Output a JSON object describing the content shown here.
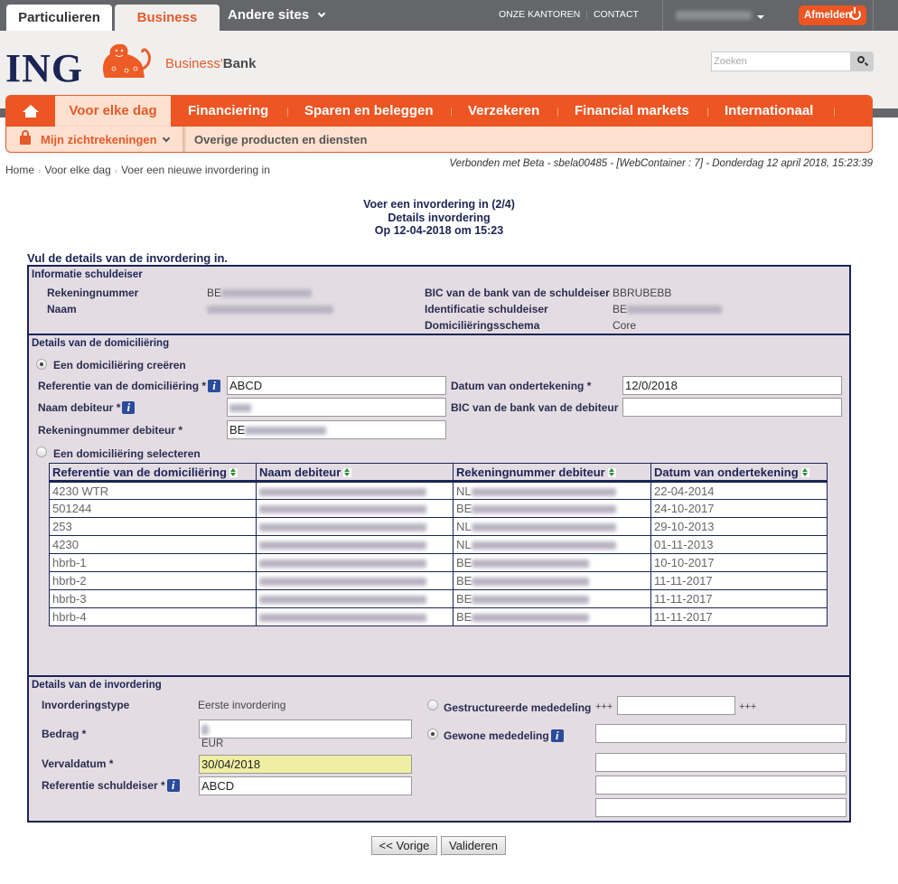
{
  "topbar": {
    "tabs": [
      "Particulieren",
      "Business"
    ],
    "other_sites": "Andere sites",
    "links": [
      "ONZE KANTOREN",
      "CONTACT"
    ],
    "logout": "Afmelden"
  },
  "header": {
    "logo": "ING",
    "brand_prefix": "Business'",
    "brand_suffix": "Bank",
    "search_placeholder": "Zoeken"
  },
  "nav": {
    "items": [
      "Voor elke dag",
      "Financiering",
      "Sparen en beleggen",
      "Verzekeren",
      "Financial markets",
      "Internationaal"
    ],
    "sub_items": [
      "Mijn zichtrekeningen",
      "Overige producten en diensten"
    ]
  },
  "breadcrumb": [
    "Home",
    "Voor elke dag",
    "Voer een nieuwe invordering in"
  ],
  "connection_info": "Verbonden met Beta - sbela00485 - [WebContainer : 7] - Donderdag 12 april 2018, 15:23:39",
  "page": {
    "title_line1": "Voer een invordering in (2/4)",
    "title_line2": "Details invordering",
    "title_line3": "Op 12-04-2018 om 15:23",
    "instructions": "Vul de details van de invordering in."
  },
  "creditor": {
    "section_title": "Informatie schuldeiser",
    "account_label": "Rekeningnummer",
    "account_prefix": "BE",
    "name_label": "Naam",
    "bic_label": "BIC van de bank van de schuldeiser",
    "bic_value": "BBRUBEBB",
    "id_label": "Identificatie schuldeiser",
    "id_prefix": "BE",
    "scheme_label": "Domiciliëringsschema",
    "scheme_value": "Core"
  },
  "mandate": {
    "section_title": "Details van de domiciliëring",
    "create_option": "Een domiciliëring creëren",
    "ref_label": "Referentie van de domiciliëring *",
    "ref_value": "ABCD",
    "date_label": "Datum van ondertekening *",
    "date_value": "12/0/2018",
    "debtor_name_label": "Naam debiteur *",
    "debtor_bic_label": "BIC van de bank van de debiteur",
    "debtor_bic_value": "",
    "debtor_account_label": "Rekeningnummer debiteur *",
    "debtor_account_prefix": "BE",
    "select_option": "Een domiciliëring selecteren",
    "table": {
      "headers": [
        "Referentie van de domiciliëring",
        "Naam debiteur",
        "Rekeningnummer debiteur",
        "Datum van ondertekening"
      ],
      "rows": [
        {
          "ref": "4230 WTR",
          "account_prefix": "NL",
          "date": "22-04-2014"
        },
        {
          "ref": "501244",
          "account_prefix": "BE",
          "date": "24-10-2017"
        },
        {
          "ref": "253",
          "account_prefix": "NL",
          "date": "29-10-2013"
        },
        {
          "ref": "4230",
          "account_prefix": "NL",
          "date": "01-11-2013"
        },
        {
          "ref": "hbrb-1",
          "account_prefix": "BE",
          "date": "10-10-2017"
        },
        {
          "ref": "hbrb-2",
          "account_prefix": "BE",
          "date": "11-11-2017"
        },
        {
          "ref": "hbrb-3",
          "account_prefix": "BE",
          "date": "11-11-2017"
        },
        {
          "ref": "hbrb-4",
          "account_prefix": "BE",
          "date": "11-11-2017"
        }
      ]
    }
  },
  "collection": {
    "section_title": "Details van de invordering",
    "type_label": "Invorderingstype",
    "type_value": "Eerste invordering",
    "amount_label": "Bedrag *",
    "currency": "EUR",
    "due_label": "Vervaldatum *",
    "due_value": "30/04/2018",
    "creditor_ref_label": "Referentie schuldeiser *",
    "creditor_ref_value": "ABCD",
    "structured_label": "Gestructureerde mededeling",
    "structured_affix": "+++",
    "free_label": "Gewone mededeling"
  },
  "buttons": {
    "previous": "<< Vorige",
    "validate": "Valideren"
  }
}
